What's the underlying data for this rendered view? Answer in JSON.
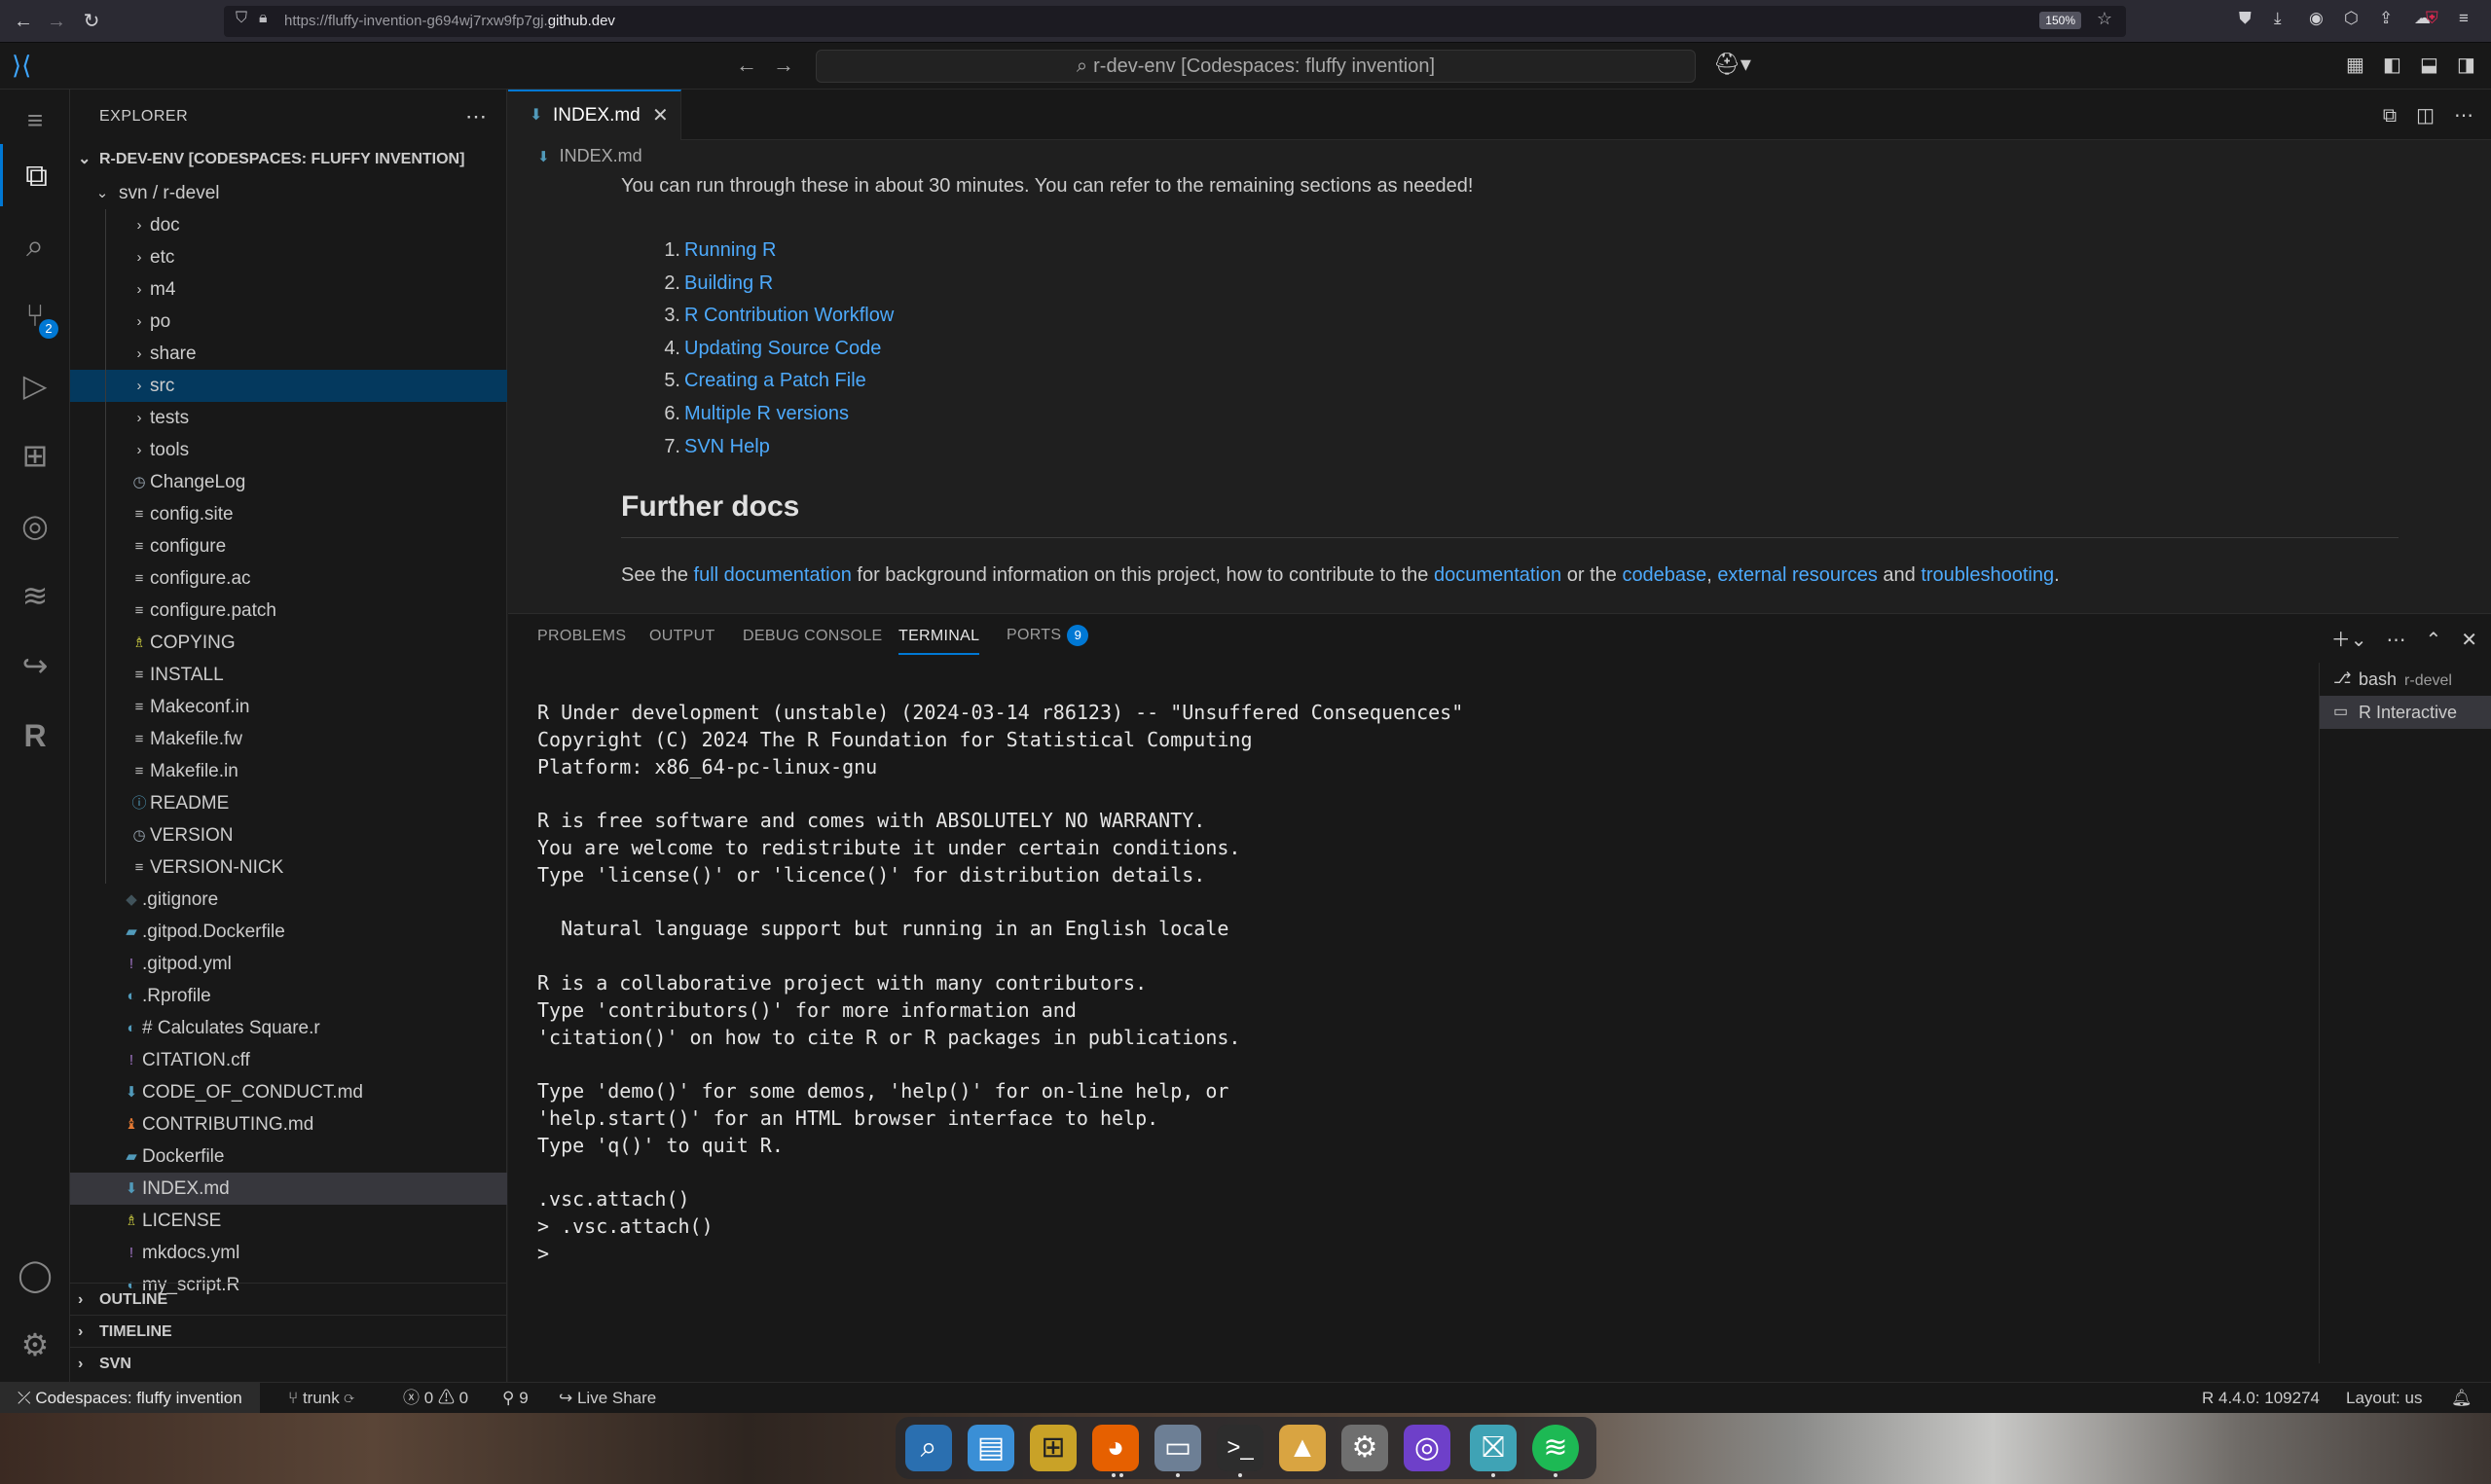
{
  "browser": {
    "url_prefix": "https://fluffy-invention-g694wj7rxw9fp7gj.",
    "url_domain": "github.dev",
    "zoom": "150%"
  },
  "title": {
    "command_center": "r-dev-env [Codespaces: fluffy invention]"
  },
  "activity": {
    "scm_badge": "2"
  },
  "explorer": {
    "header": "EXPLORER",
    "workspace": "R-DEV-ENV [CODESPACES: FLUFFY INVENTION]",
    "root_folder": "svn / r-devel",
    "items": [
      {
        "label": "doc",
        "type": "folder",
        "depth": 2
      },
      {
        "label": "etc",
        "type": "folder",
        "depth": 2
      },
      {
        "label": "m4",
        "type": "folder",
        "depth": 2
      },
      {
        "label": "po",
        "type": "folder",
        "depth": 2
      },
      {
        "label": "share",
        "type": "folder",
        "depth": 2
      },
      {
        "label": "src",
        "type": "folder",
        "depth": 2,
        "focused": true
      },
      {
        "label": "tests",
        "type": "folder",
        "depth": 2
      },
      {
        "label": "tools",
        "type": "folder",
        "depth": 2
      },
      {
        "label": "ChangeLog",
        "type": "clock",
        "depth": 2
      },
      {
        "label": "config.site",
        "type": "lines",
        "depth": 2
      },
      {
        "label": "configure",
        "type": "lines",
        "depth": 2
      },
      {
        "label": "configure.ac",
        "type": "lines",
        "depth": 2
      },
      {
        "label": "configure.patch",
        "type": "lines",
        "depth": 2
      },
      {
        "label": "COPYING",
        "type": "license",
        "depth": 2
      },
      {
        "label": "INSTALL",
        "type": "lines",
        "depth": 2
      },
      {
        "label": "Makeconf.in",
        "type": "lines",
        "depth": 2
      },
      {
        "label": "Makefile.fw",
        "type": "lines",
        "depth": 2
      },
      {
        "label": "Makefile.in",
        "type": "lines",
        "depth": 2
      },
      {
        "label": "README",
        "type": "info",
        "depth": 2
      },
      {
        "label": "VERSION",
        "type": "clock",
        "depth": 2
      },
      {
        "label": "VERSION-NICK",
        "type": "lines",
        "depth": 2
      },
      {
        "label": ".gitignore",
        "type": "git",
        "depth": 1
      },
      {
        "label": ".gitpod.Dockerfile",
        "type": "docker",
        "depth": 1
      },
      {
        "label": ".gitpod.yml",
        "type": "yaml",
        "depth": 1
      },
      {
        "label": ".Rprofile",
        "type": "r",
        "depth": 1
      },
      {
        "label": "# Calculates Square.r",
        "type": "r",
        "depth": 1
      },
      {
        "label": "CITATION.cff",
        "type": "yaml",
        "depth": 1
      },
      {
        "label": "CODE_OF_CONDUCT.md",
        "type": "md",
        "depth": 1
      },
      {
        "label": "CONTRIBUTING.md",
        "type": "contrib",
        "depth": 1
      },
      {
        "label": "Dockerfile",
        "type": "docker",
        "depth": 1
      },
      {
        "label": "INDEX.md",
        "type": "md",
        "depth": 1,
        "selected": true
      },
      {
        "label": "LICENSE",
        "type": "license",
        "depth": 1
      },
      {
        "label": "mkdocs.yml",
        "type": "yaml",
        "depth": 1
      },
      {
        "label": "my_script.R",
        "type": "r",
        "depth": 1
      }
    ],
    "sections": [
      "OUTLINE",
      "TIMELINE",
      "SVN"
    ]
  },
  "editor": {
    "tab_label": "INDEX.md",
    "breadcrumb": "INDEX.md",
    "intro": "You can run through these in about 30 minutes. You can refer to the remaining sections as needed!",
    "list": [
      {
        "n": "1.",
        "text": "Running R"
      },
      {
        "n": "2.",
        "text": "Building R"
      },
      {
        "n": "3.",
        "text": "R Contribution Workflow"
      },
      {
        "n": "4.",
        "text": "Updating Source Code"
      },
      {
        "n": "5.",
        "text": "Creating a Patch File"
      },
      {
        "n": "6.",
        "text": "Multiple R versions"
      },
      {
        "n": "7.",
        "text": "SVN Help"
      }
    ],
    "heading": "Further docs",
    "further": {
      "t1": "See the ",
      "l1": "full documentation",
      "t2": " for background information on this project, how to contribute to the ",
      "l2": "documentation",
      "t3": " or the ",
      "l3": "codebase",
      "t4": ", ",
      "l4": "external resources",
      "t5": " and ",
      "l5": "troubleshooting",
      "t6": "."
    }
  },
  "panel": {
    "tabs": {
      "problems": "PROBLEMS",
      "output": "OUTPUT",
      "debug": "DEBUG CONSOLE",
      "terminal": "TERMINAL",
      "ports": "PORTS",
      "ports_badge": "9"
    },
    "terminal_lines": [
      "R Under development (unstable) (2024-03-14 r86123) -- \"Unsuffered Consequences\"",
      "Copyright (C) 2024 The R Foundation for Statistical Computing",
      "Platform: x86_64-pc-linux-gnu",
      "",
      "R is free software and comes with ABSOLUTELY NO WARRANTY.",
      "You are welcome to redistribute it under certain conditions.",
      "Type 'license()' or 'licence()' for distribution details.",
      "",
      "  Natural language support but running in an English locale",
      "",
      "R is a collaborative project with many contributors.",
      "Type 'contributors()' for more information and",
      "'citation()' on how to cite R or R packages in publications.",
      "",
      "Type 'demo()' for some demos, 'help()' for on-line help, or",
      "'help.start()' for an HTML browser interface to help.",
      "Type 'q()' to quit R.",
      "",
      ".vsc.attach()",
      "> .vsc.attach()",
      "> "
    ],
    "terminals": [
      {
        "name": "bash",
        "sub": "r-devel"
      },
      {
        "name": "R Interactive",
        "sub": ""
      }
    ]
  },
  "status": {
    "remote": "Codespaces: fluffy invention",
    "branch": "trunk",
    "errors": "0",
    "warnings": "0",
    "ports": "9",
    "live_share": "Live Share",
    "r_version": "R 4.4.0: 109274",
    "layout": "Layout: us"
  }
}
